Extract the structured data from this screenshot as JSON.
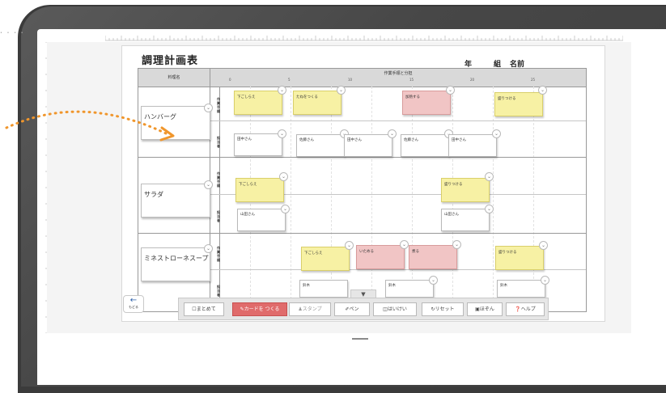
{
  "sheet": {
    "title": "調理計画表",
    "name_fields": [
      "年",
      "組",
      "名前"
    ],
    "header": {
      "dish_column": "料理名",
      "work_column": "作業手順と分担",
      "time_ticks": [
        "0",
        "5",
        "10",
        "15",
        "20",
        "25"
      ]
    },
    "row_labels": {
      "steps": "作\n業\n手\n順",
      "assignee": "担\n当\n者"
    },
    "dishes": [
      {
        "name": "ハンバーグ",
        "steps": [
          {
            "label": "下ごしらえ",
            "color": "yellow"
          },
          {
            "label": "たねをつくる",
            "color": "yellow"
          },
          {
            "label": "加熱する",
            "color": "pink"
          },
          {
            "label": "盛りつける",
            "color": "yellow"
          }
        ],
        "assignees": [
          "田中さん",
          "佐藤さん",
          "田中さん",
          "佐藤さん",
          "田中さん"
        ]
      },
      {
        "name": "サラダ",
        "steps": [
          {
            "label": "下ごしらえ",
            "color": "yellow"
          },
          {
            "label": "盛りつける",
            "color": "yellow"
          }
        ],
        "assignees": [
          "山田さん",
          "山田さん"
        ]
      },
      {
        "name": "ミネストローネスープ",
        "steps": [
          {
            "label": "下ごしらえ",
            "color": "yellow"
          },
          {
            "label": "いためる",
            "color": "pink"
          },
          {
            "label": "煮る",
            "color": "pink"
          },
          {
            "label": "盛りつける",
            "color": "yellow"
          }
        ],
        "assignees": [
          "鈴木",
          "鈴木",
          "鈴木"
        ]
      }
    ]
  },
  "toolbar": {
    "group": "まとめて",
    "make_card": "カードを つくる",
    "stamp": "スタンプ",
    "pen": "ペン",
    "erase": "はいけい",
    "reset": "リセット",
    "save": "ほぞん",
    "help": "ヘルプ",
    "drawer_toggle": "▼"
  },
  "back_button": {
    "icon": "←",
    "label": "もどる"
  },
  "colors": {
    "yellow_card": "#f7f1a4",
    "pink_card": "#f1c5c5",
    "primary_button": "#e06b6b",
    "pointer_arrow": "#f0962c"
  }
}
